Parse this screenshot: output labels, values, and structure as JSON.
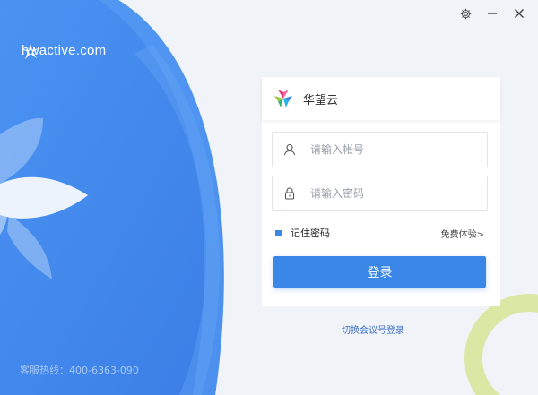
{
  "brand": {
    "site": "hwactive.com"
  },
  "hotline": "客服热线：400-6363-090",
  "window": {
    "settings_icon": "gear-icon",
    "minimize_icon": "minimize-icon",
    "close_icon": "close-icon"
  },
  "card": {
    "title": "华望云",
    "account_placeholder": "请输入帐号",
    "password_placeholder": "请输入密码",
    "remember_label": "记住密码",
    "trial_label": "免费体验>",
    "login_label": "登录"
  },
  "switch_label": "切换会议号登录",
  "colors": {
    "primary": "#3a86e6",
    "panel_blue": "#4a8ff0",
    "ring": "#dbe7a4"
  }
}
